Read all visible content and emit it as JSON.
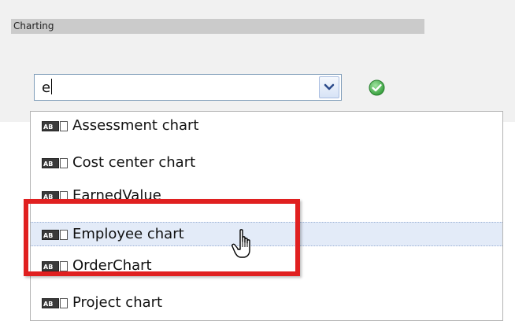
{
  "section": {
    "title": "Charting"
  },
  "combo": {
    "value": "e"
  },
  "icons": {
    "dropdown": "chevron-down-icon",
    "confirm": "checkmark-circle-icon",
    "item": "text-field-icon",
    "cursor": "hand-pointer-icon"
  },
  "dropdown": {
    "items": [
      {
        "label": "Assessment chart"
      },
      {
        "label": "Cost center chart"
      },
      {
        "label": "EarnedValue"
      },
      {
        "label": "Employee chart",
        "hovered": true
      },
      {
        "label": "OrderChart"
      },
      {
        "label": "Project chart"
      }
    ]
  },
  "colors": {
    "highlight": "#e02020",
    "hover_row": "#e3ebf8",
    "confirm_green": "#3cb043"
  }
}
